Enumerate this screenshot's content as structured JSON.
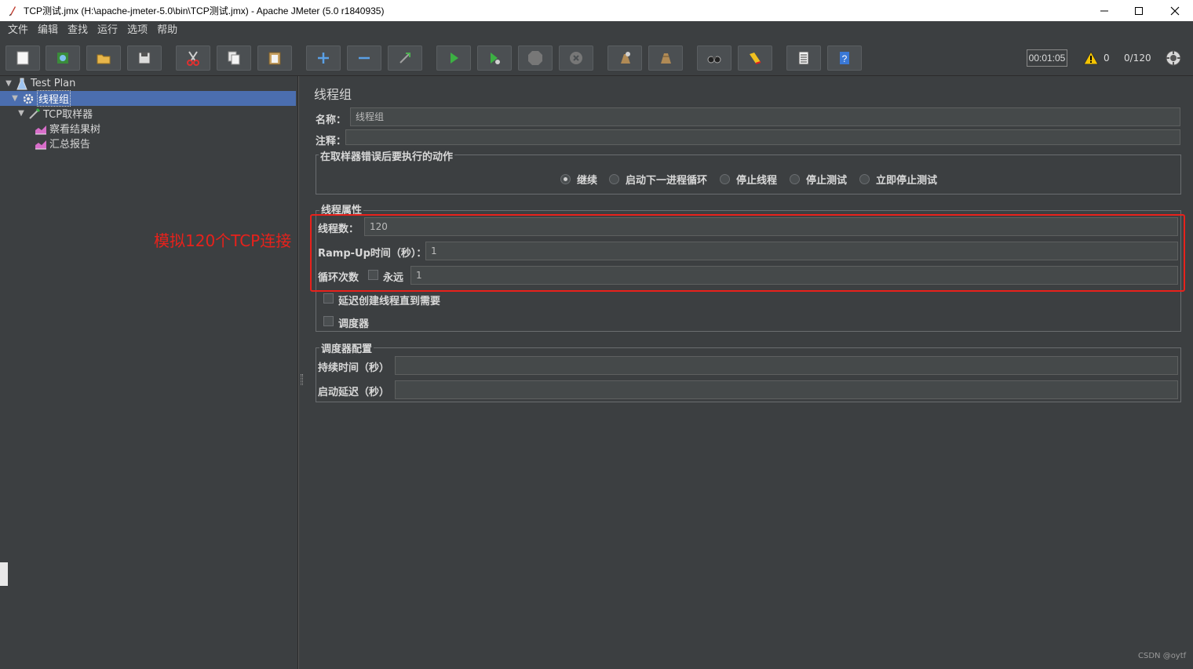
{
  "window": {
    "title": "TCP测试.jmx (H:\\apache-jmeter-5.0\\bin\\TCP测试.jmx) - Apache JMeter (5.0 r1840935)",
    "controls": [
      "—",
      "☐",
      "✕"
    ]
  },
  "menu": [
    "文件",
    "编辑",
    "查找",
    "运行",
    "选项",
    "帮助"
  ],
  "toolbar": {
    "buttons": [
      "new-icon",
      "templates-icon",
      "open-icon",
      "save-icon",
      "cut-icon",
      "copy-icon",
      "paste-icon",
      "expand-icon",
      "collapse-icon",
      "toggle-icon",
      "start-icon",
      "start-no-pause-icon",
      "stop-icon",
      "shutdown-icon",
      "clear-icon",
      "clear-all-icon",
      "search-icon",
      "reset-search-icon",
      "function-helper-icon",
      "help-icon"
    ],
    "timer": "00:01:05",
    "warnings": "0",
    "threads": "0/120"
  },
  "tree": {
    "test_plan": "Test Plan",
    "thread_group": "线程组",
    "sampler": "TCP取样器",
    "listener1": "察看结果树",
    "listener2": "汇总报告"
  },
  "form": {
    "title": "线程组",
    "name_label": "名称：",
    "name_value": "线程组",
    "comment_label": "注释：",
    "comment_value": "",
    "error_group_title": "在取样器错误后要执行的动作",
    "error_actions": [
      "继续",
      "启动下一进程循环",
      "停止线程",
      "停止测试",
      "立即停止测试"
    ],
    "error_selected": "继续",
    "thread_props_title": "线程属性",
    "threads_label": "线程数：",
    "threads_value": "120",
    "rampup_label": "Ramp-Up时间（秒）：",
    "rampup_value": "1",
    "loop_label": "循环次数",
    "forever_label": "永远",
    "loop_value": "1",
    "delay_label": "延迟创建线程直到需要",
    "scheduler_label": "调度器",
    "scheduler_config_title": "调度器配置",
    "duration_label": "持续时间（秒）",
    "duration_value": "",
    "startup_delay_label": "启动延迟（秒）",
    "startup_delay_value": ""
  },
  "annotation": "模拟120个TCP连接",
  "watermark": "CSDN @oytf",
  "colors": {
    "background": "#3c3f41",
    "selection": "#4b6eaf",
    "annotation": "#e8211b"
  }
}
